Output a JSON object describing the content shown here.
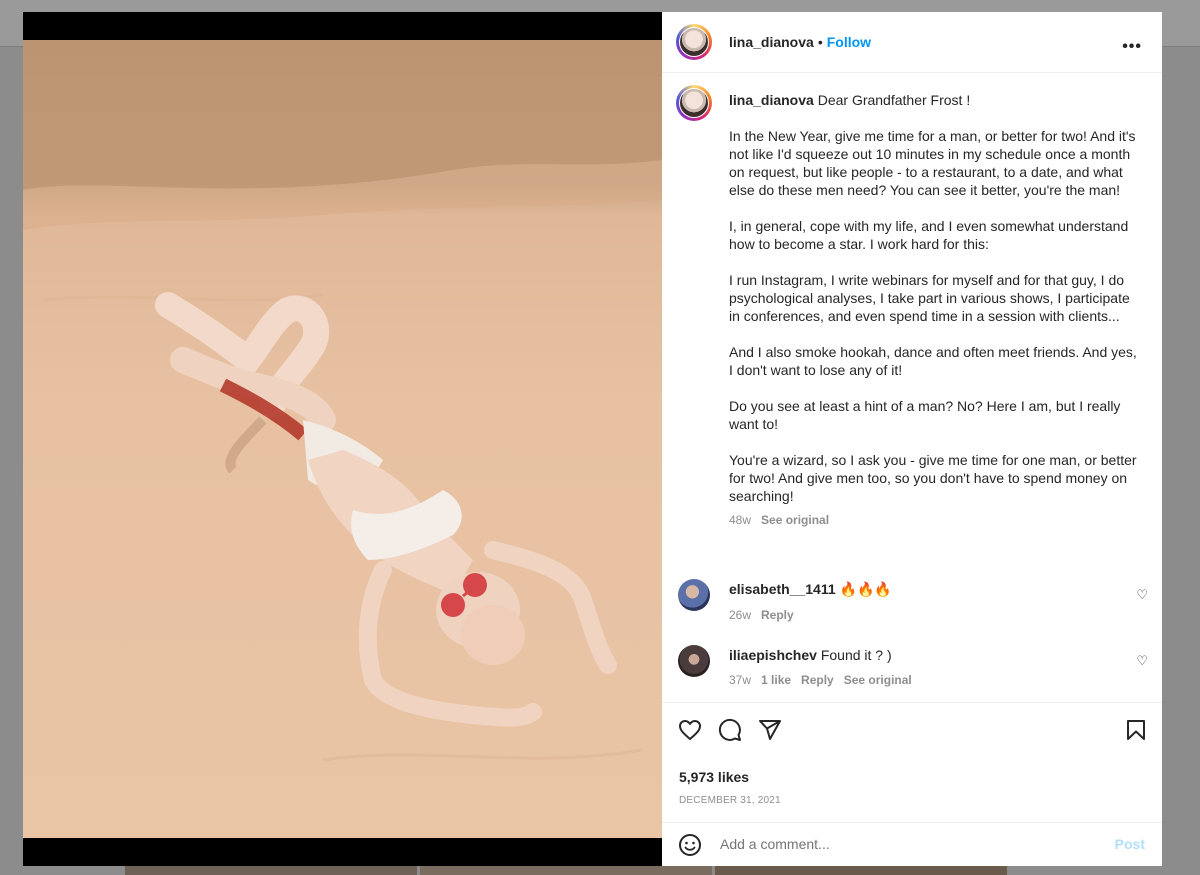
{
  "post": {
    "author": "lina_dianova",
    "separator": "•",
    "follow_label": "Follow",
    "more_label": "•••",
    "caption_opening": "Dear Grandfather Frost !",
    "caption_paragraphs": [
      "In the New Year, give me time for a man, or better for two! And it's not like I'd squeeze out 10 minutes in my schedule once a month on request, but like people - to a restaurant, to a date, and what else do these men need? You can see it better, you're the man!",
      "I, in general, cope with my life, and I even somewhat understand how to become a star. I work hard for this:",
      "I run Instagram, I write webinars for myself and for that guy, I do psychological analyses, I take part in various shows, I participate in conferences, and even spend time in a session with clients...",
      "And I also smoke hookah, dance and often meet friends. And yes, I don't want to lose any of it!",
      "Do you see at least a hint of a man? No? Here I am, but I really want to!",
      "You're a wizard, so I ask you - give me time for one man, or better for two! And give men too, so you don't have to spend money on searching!"
    ],
    "caption_age": "48w",
    "see_original": "See original",
    "likes": "5,973 likes",
    "date": "DECEMBER 31, 2021",
    "add_comment_placeholder": "Add a comment...",
    "post_label": "Post"
  },
  "comments": [
    {
      "user": "elisabeth__1411",
      "text": "🔥🔥🔥",
      "age": "26w",
      "likes": "",
      "reply": "Reply",
      "see_original": ""
    },
    {
      "user": "iliaepishchev",
      "text": "Found it ? )",
      "age": "37w",
      "likes": "1 like",
      "reply": "Reply",
      "see_original": "See original"
    }
  ],
  "colors": {
    "accent": "#0095f6",
    "post_disabled": "#b2dffc",
    "muted": "#8e8e8e"
  },
  "icons": [
    "heart-icon",
    "comment-icon",
    "share-icon",
    "bookmark-icon",
    "emoji-icon",
    "more-options-icon"
  ]
}
